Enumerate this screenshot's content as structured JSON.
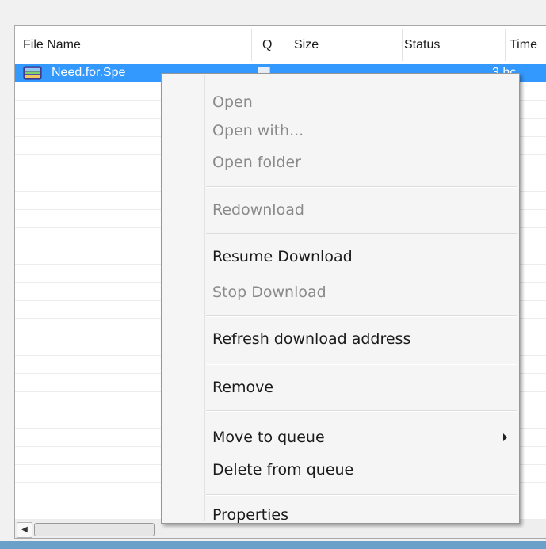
{
  "columns": {
    "file_name": "File Name",
    "q": "Q",
    "size": "Size",
    "status": "Status",
    "time": "Time"
  },
  "selected_row": {
    "file_name": "Need.for.Spe",
    "time": "3 hc"
  },
  "context_menu": {
    "open": "Open",
    "open_with": "Open with...",
    "open_folder": "Open folder",
    "redownload": "Redownload",
    "resume_download": "Resume Download",
    "stop_download": "Stop Download",
    "refresh_address": "Refresh download address",
    "remove": "Remove",
    "move_to_queue": "Move to queue",
    "delete_from_queue": "Delete from queue",
    "properties": "Properties"
  },
  "colors": {
    "selection": "#3399ff",
    "disabled_text": "#8a8a8a"
  }
}
